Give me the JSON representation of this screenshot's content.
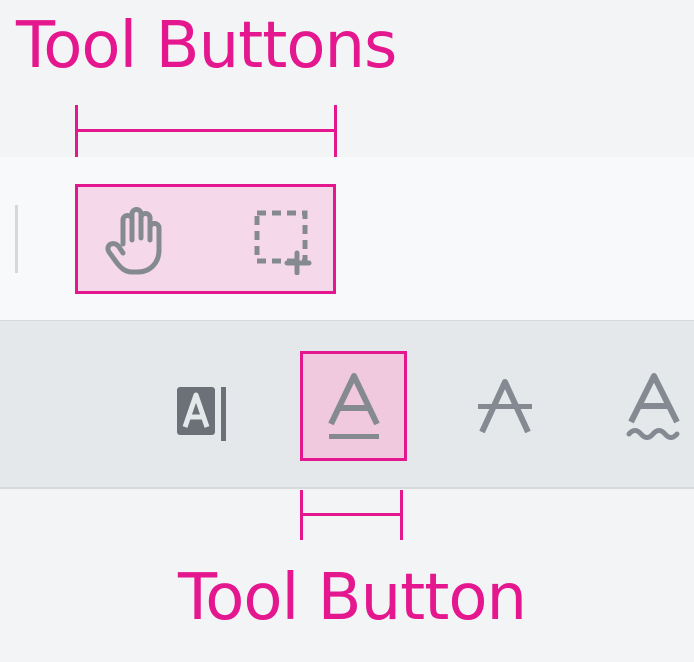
{
  "annotations": {
    "group_label": "Tool Buttons",
    "single_label": "Tool Button"
  },
  "colors": {
    "annotation": "#e4178f",
    "highlight_fill": "#f5d9ea",
    "icon": "#858a92",
    "icon_dark": "#6c7077"
  },
  "toolbar_top": {
    "group_buttons": [
      {
        "icon": "pan-hand-icon"
      },
      {
        "icon": "area-select-icon"
      }
    ]
  },
  "toolbar_bottom": {
    "buttons": [
      {
        "icon": "text-field-icon"
      },
      {
        "icon": "text-underline-icon",
        "highlighted": true
      },
      {
        "icon": "text-strikeout-icon"
      },
      {
        "icon": "text-squiggly-icon"
      }
    ]
  }
}
